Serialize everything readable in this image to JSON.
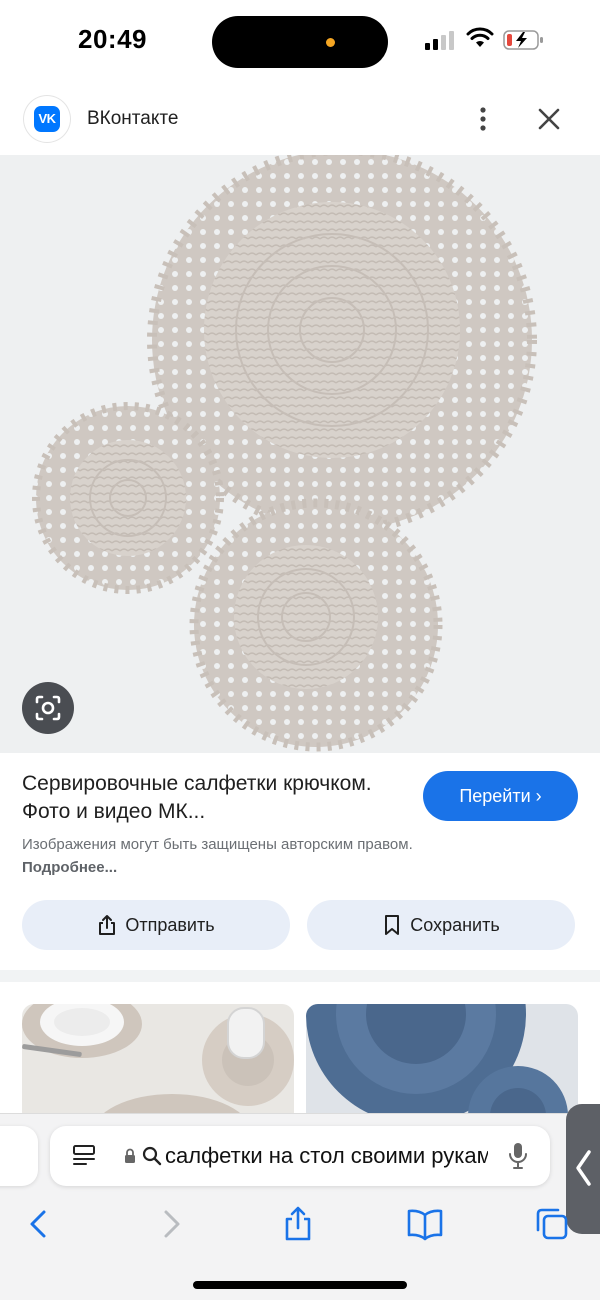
{
  "status_bar": {
    "time": "20:49",
    "icons": [
      "signal-icon",
      "wifi-icon",
      "battery-charging-icon"
    ],
    "battery_color": "#e5483d"
  },
  "header": {
    "site_name": "ВКонтакте",
    "logo_text": "VK",
    "logo_color": "#0077ff",
    "icons": [
      "more-vertical-icon",
      "close-icon"
    ]
  },
  "result": {
    "title": "Сервировочные салфетки крючком. Фото и видео МК...",
    "visit_label": "Перейти ›",
    "copyright_text": "Изображения могут быть защищены авторским правом.",
    "more_link": "Подробнее...",
    "share_label": "Отправить",
    "save_label": "Сохранить",
    "accent_color": "#1a73e8"
  },
  "browser": {
    "address_text": "салфетки на стол своими руками",
    "icons": [
      "reader-icon",
      "lock-icon",
      "search-icon",
      "mic-icon",
      "back-icon",
      "forward-icon",
      "share-icon",
      "bookmarks-icon",
      "tabs-icon"
    ]
  }
}
